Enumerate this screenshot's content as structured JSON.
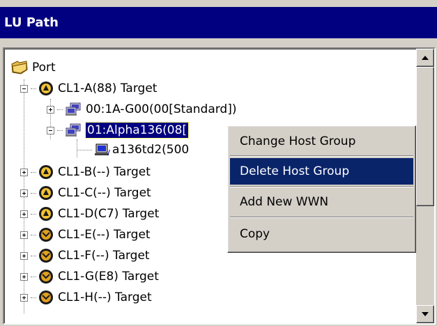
{
  "panel": {
    "title": "LU Path"
  },
  "tree": {
    "root": {
      "label": "Port",
      "icon": "folder-icon"
    },
    "ports": [
      {
        "label": "CL1-A(88) Target",
        "expanded": true
      },
      {
        "label": "00:1A-G00(00[Standard])"
      },
      {
        "label": "01:Alpha136(08["
      },
      {
        "label": "a136td2(500"
      },
      {
        "label": "CL1-B(--) Target"
      },
      {
        "label": "CL1-C(--) Target"
      },
      {
        "label": "CL1-D(C7) Target"
      },
      {
        "label": "CL1-E(--) Target"
      },
      {
        "label": "CL1-F(--) Target"
      },
      {
        "label": "CL1-G(E8) Target"
      },
      {
        "label": "CL1-H(--) Target"
      }
    ]
  },
  "context_menu": {
    "items": [
      {
        "label": "Change Host Group"
      },
      {
        "label": "Delete Host Group",
        "highlighted": true
      },
      {
        "label": "Add New WWN"
      },
      {
        "label": "Copy"
      }
    ]
  },
  "colors": {
    "title_bg": "#000080",
    "selection": "#000080",
    "menu_highlight": "#0a246a",
    "chrome": "#d4d0c8"
  }
}
